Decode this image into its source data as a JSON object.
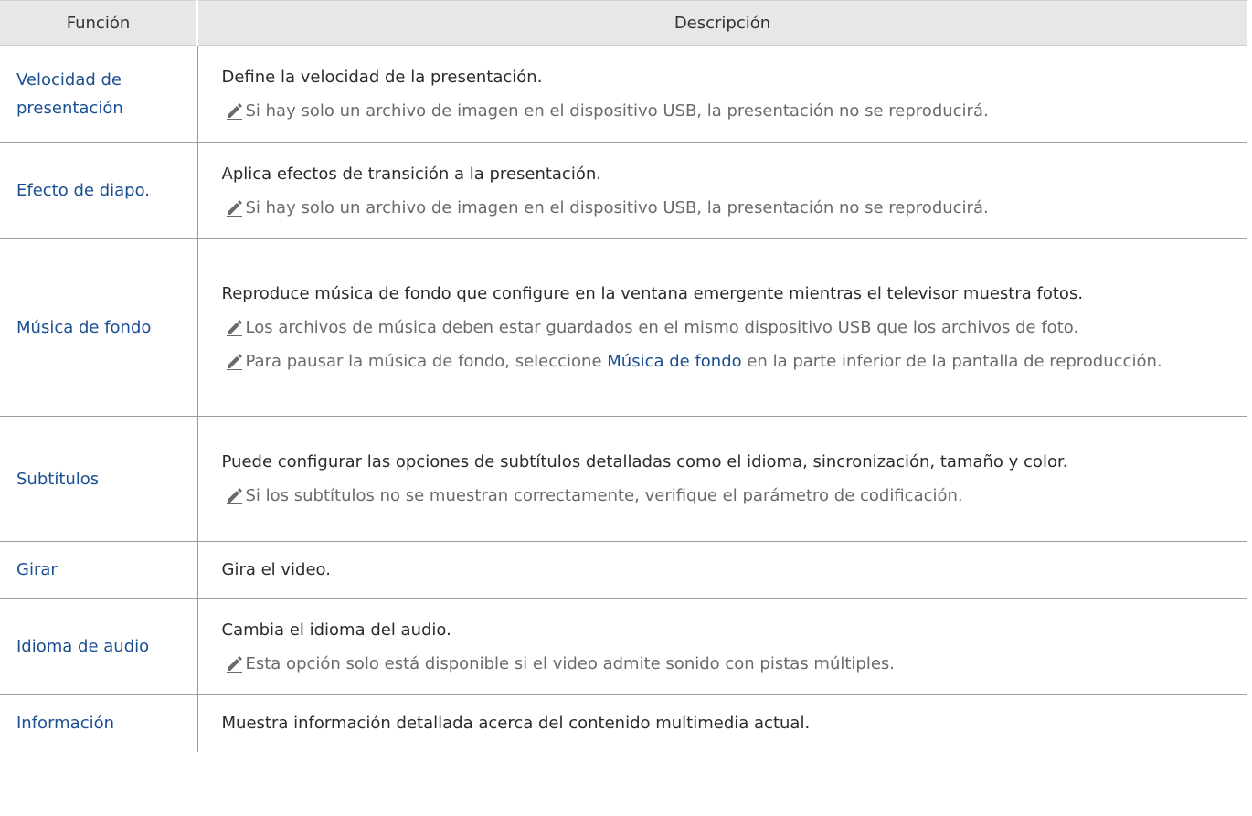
{
  "headers": {
    "function": "Función",
    "description": "Descripción"
  },
  "rows": [
    {
      "function": "Velocidad de presentación",
      "description": "Define la velocidad de la presentación.",
      "notes": [
        "Si hay solo un archivo de imagen en el dispositivo USB, la presentación no se reproducirá."
      ]
    },
    {
      "function": "Efecto de diapo.",
      "description": "Aplica efectos de transición a la presentación.",
      "notes": [
        "Si hay solo un archivo de imagen en el dispositivo USB, la presentación no se reproducirá."
      ]
    },
    {
      "function": "Música de fondo",
      "description": "Reproduce música de fondo que configure en la ventana emergente mientras el televisor muestra fotos.",
      "notes": [
        "Los archivos de música deben estar guardados en el mismo dispositivo USB que los archivos de foto."
      ],
      "note_pause": {
        "before": "Para pausar la música de fondo, seleccione ",
        "link": "Música de fondo",
        "after": " en la parte inferior de la pantalla de reproducción."
      }
    },
    {
      "function": "Subtítulos",
      "description": "Puede configurar las opciones de subtítulos detalladas como el idioma, sincronización, tamaño y color.",
      "notes": [
        "Si los subtítulos no se muestran correctamente, verifique el parámetro de codificación."
      ]
    },
    {
      "function": "Girar",
      "description": "Gira el video.",
      "notes": []
    },
    {
      "function": "Idioma de audio",
      "description": "Cambia el idioma del audio.",
      "notes": [
        "Esta opción solo está disponible si el video admite sonido con pistas múltiples."
      ]
    },
    {
      "function": "Información",
      "description": "Muestra información detallada acerca del contenido multimedia actual.",
      "notes": []
    }
  ],
  "colors": {
    "link": "#1b4f92",
    "header_bg": "#e7e7e7",
    "note_text": "#6a6a6a"
  },
  "icons": {
    "note": "pencil-icon"
  }
}
